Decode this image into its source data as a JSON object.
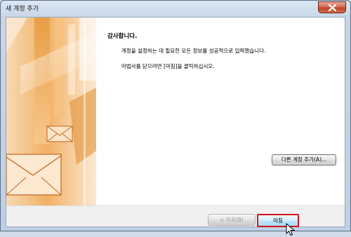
{
  "window": {
    "title": "새 계정 추가"
  },
  "content": {
    "heading": "감사합니다.",
    "message_1": "계정을 설정하는 데 필요한 모든 정보를 성공적으로 입력했습니다.",
    "message_2": "마법사를 닫으려면 [마침]을 클릭하십시오."
  },
  "buttons": {
    "add_another_account": "다른 계정 추가(A)...",
    "back": "< 뒤로(B)",
    "finish": "마침"
  },
  "colors": {
    "highlight_box": "#d4141a",
    "art_orange": "#f2a65a",
    "art_dark": "#c8761e"
  },
  "icons": {
    "close": "close-icon",
    "envelope": "envelope-icon",
    "cursor": "mouse-cursor-icon"
  }
}
